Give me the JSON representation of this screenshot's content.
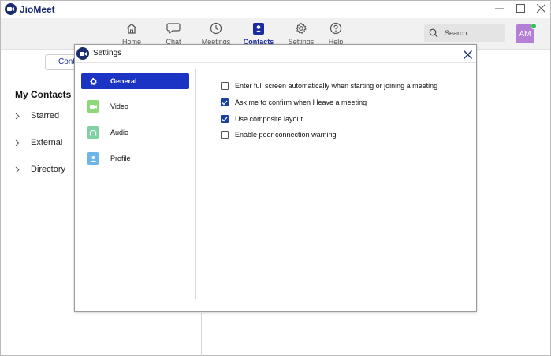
{
  "app": {
    "title": "JioMeet",
    "brand_color": "#1b2c6f",
    "accent_color": "#1b34c4"
  },
  "window_controls": [
    {
      "name": "minimize-icon"
    },
    {
      "name": "maximize-icon"
    },
    {
      "name": "close-icon"
    }
  ],
  "nav": {
    "items": [
      {
        "label": "Home",
        "icon": "home-icon",
        "active": false
      },
      {
        "label": "Chat",
        "icon": "chat-icon",
        "active": false
      },
      {
        "label": "Meetings",
        "icon": "clock-icon",
        "active": false
      },
      {
        "label": "Contacts",
        "icon": "contacts-icon",
        "active": true
      },
      {
        "label": "Settings",
        "icon": "gear-icon",
        "active": false
      },
      {
        "label": "Help",
        "icon": "help-icon",
        "active": false
      }
    ],
    "search_label": "Search",
    "avatar_initials": "AM",
    "presence_color": "#2bc94a"
  },
  "contacts": {
    "tab_label": "Cont",
    "heading": "My Contacts",
    "groups": [
      "Starred",
      "External",
      "Directory"
    ]
  },
  "settings": {
    "title": "Settings",
    "sidebar": [
      {
        "label": "General",
        "icon": "gear-icon",
        "active": true
      },
      {
        "label": "Video",
        "icon": "video-icon",
        "active": false,
        "color": "#8fd87a"
      },
      {
        "label": "Audio",
        "icon": "headphones-icon",
        "active": false,
        "color": "#7fd3a0"
      },
      {
        "label": "Profile",
        "icon": "profile-icon",
        "active": false,
        "color": "#6fb6e8"
      }
    ],
    "options": [
      {
        "label": "Enter full screen automatically when starting or joining a meeting",
        "checked": false
      },
      {
        "label": "Ask me to confirm when I leave a meeting",
        "checked": true
      },
      {
        "label": "Use composite layout",
        "checked": true
      },
      {
        "label": "Enable poor connection warning",
        "checked": false
      }
    ]
  }
}
